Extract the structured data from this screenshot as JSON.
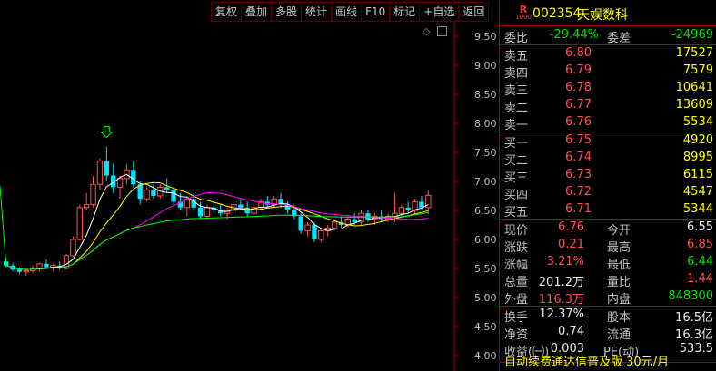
{
  "toolbar": {
    "buttons": [
      "复权",
      "叠加",
      "多股",
      "统计",
      "画线",
      "F10",
      "标记",
      "+自选",
      "返回"
    ]
  },
  "axis": {
    "ticks": [
      "9.50",
      "9.00",
      "8.50",
      "8.00",
      "7.50",
      "7.00",
      "6.50",
      "6.00",
      "5.50",
      "5.00",
      "4.50",
      "4.00"
    ],
    "tick_values": [
      9.5,
      9.0,
      8.5,
      8.0,
      7.5,
      7.0,
      6.5,
      6.0,
      5.5,
      5.0,
      4.5,
      4.0
    ]
  },
  "stock": {
    "badge_letter": "R",
    "badge_num": "1000",
    "code": "002354",
    "name": "天娱数科"
  },
  "commission": {
    "ratio_label": "委比",
    "ratio_value": "-29.44%",
    "diff_label": "委差",
    "diff_value": "-24969"
  },
  "asks": [
    {
      "label": "卖五",
      "price": "6.80",
      "volume": "17527"
    },
    {
      "label": "卖四",
      "price": "6.79",
      "volume": "7579"
    },
    {
      "label": "卖三",
      "price": "6.78",
      "volume": "10641"
    },
    {
      "label": "卖二",
      "price": "6.77",
      "volume": "13609"
    },
    {
      "label": "卖一",
      "price": "6.76",
      "volume": "5534"
    }
  ],
  "bids": [
    {
      "label": "买一",
      "price": "6.75",
      "volume": "4920"
    },
    {
      "label": "买二",
      "price": "6.74",
      "volume": "8995"
    },
    {
      "label": "买三",
      "price": "6.73",
      "volume": "6115"
    },
    {
      "label": "买四",
      "price": "6.72",
      "volume": "4547"
    },
    {
      "label": "买五",
      "price": "6.71",
      "volume": "5344"
    }
  ],
  "quote": {
    "current_label": "现价",
    "current": "6.76",
    "open_label": "今开",
    "open": "6.55",
    "change_label": "涨跌",
    "change": "0.21",
    "high_label": "最高",
    "high": "6.85",
    "pct_label": "涨幅",
    "pct": "3.21%",
    "low_label": "最低",
    "low": "6.44",
    "volume_label": "总量",
    "volume": "201.2万",
    "vol_ratio_label": "量比",
    "vol_ratio": "1.44",
    "outer_label": "外盘",
    "outer": "116.3万",
    "inner_label": "内盘",
    "inner": "848300"
  },
  "fundamentals": {
    "turnover_label": "换手",
    "turnover": "12.37%",
    "equity_label": "股本",
    "equity": "16.5亿",
    "netasset_label": "净资",
    "netasset": "0.74",
    "float_label": "流通",
    "float": "16.3亿",
    "eps_label": "收益(㈠)",
    "eps": "0.003",
    "pe_label": "PE(动)",
    "pe": "533.5"
  },
  "ticker": "自动续费通达信普及版 30元/月",
  "colors": {
    "up": "#ff5050",
    "down": "#00e5ff",
    "ma5": "#ffffff",
    "ma10": "#ffff00",
    "ma20": "#ff00ff",
    "ma60": "#00ff00"
  },
  "chart_data": {
    "type": "candlestick",
    "ylim": [
      4.0,
      9.5
    ],
    "candles": [
      [
        5.62,
        5.68,
        5.52,
        5.55
      ],
      [
        5.55,
        5.6,
        5.45,
        5.48
      ],
      [
        5.48,
        5.52,
        5.4,
        5.44
      ],
      [
        5.44,
        5.5,
        5.38,
        5.46
      ],
      [
        5.46,
        5.55,
        5.42,
        5.5
      ],
      [
        5.5,
        5.6,
        5.45,
        5.58
      ],
      [
        5.58,
        5.65,
        5.5,
        5.52
      ],
      [
        5.52,
        5.58,
        5.45,
        5.55
      ],
      [
        5.55,
        5.62,
        5.48,
        5.5
      ],
      [
        5.5,
        5.75,
        5.48,
        5.72
      ],
      [
        5.72,
        6.05,
        5.7,
        6.0
      ],
      [
        6.0,
        6.6,
        5.98,
        6.55
      ],
      [
        6.55,
        6.8,
        6.5,
        6.6
      ],
      [
        6.6,
        7.1,
        6.55,
        6.95
      ],
      [
        6.95,
        7.4,
        6.85,
        7.35
      ],
      [
        7.35,
        7.6,
        7.0,
        7.1
      ],
      [
        7.1,
        7.3,
        6.8,
        6.9
      ],
      [
        6.9,
        7.1,
        6.7,
        7.05
      ],
      [
        7.05,
        7.3,
        6.95,
        7.2
      ],
      [
        7.2,
        7.35,
        6.9,
        6.95
      ],
      [
        6.95,
        7.0,
        6.6,
        6.7
      ],
      [
        6.7,
        6.9,
        6.65,
        6.85
      ],
      [
        6.85,
        6.95,
        6.7,
        6.75
      ],
      [
        6.75,
        6.95,
        6.7,
        6.9
      ],
      [
        6.9,
        7.05,
        6.8,
        6.85
      ],
      [
        6.85,
        6.9,
        6.6,
        6.65
      ],
      [
        6.65,
        6.8,
        6.5,
        6.55
      ],
      [
        6.55,
        6.75,
        6.4,
        6.7
      ],
      [
        6.7,
        6.8,
        6.5,
        6.55
      ],
      [
        6.55,
        6.65,
        6.35,
        6.4
      ],
      [
        6.4,
        6.6,
        6.35,
        6.55
      ],
      [
        6.55,
        6.65,
        6.45,
        6.5
      ],
      [
        6.5,
        6.6,
        6.4,
        6.45
      ],
      [
        6.45,
        6.55,
        6.35,
        6.5
      ],
      [
        6.5,
        6.65,
        6.45,
        6.6
      ],
      [
        6.6,
        6.7,
        6.5,
        6.55
      ],
      [
        6.55,
        6.65,
        6.4,
        6.45
      ],
      [
        6.45,
        6.6,
        6.4,
        6.55
      ],
      [
        6.55,
        6.7,
        6.5,
        6.65
      ],
      [
        6.65,
        6.75,
        6.55,
        6.6
      ],
      [
        6.6,
        6.75,
        6.55,
        6.7
      ],
      [
        6.7,
        6.8,
        6.55,
        6.6
      ],
      [
        6.6,
        6.65,
        6.45,
        6.5
      ],
      [
        6.5,
        6.6,
        6.35,
        6.4
      ],
      [
        6.4,
        6.45,
        6.1,
        6.15
      ],
      [
        6.15,
        6.3,
        6.05,
        6.25
      ],
      [
        6.25,
        6.3,
        5.95,
        6.0
      ],
      [
        6.0,
        6.2,
        5.95,
        6.15
      ],
      [
        6.15,
        6.25,
        6.05,
        6.2
      ],
      [
        6.2,
        6.35,
        6.15,
        6.3
      ],
      [
        6.3,
        6.4,
        6.2,
        6.25
      ],
      [
        6.25,
        6.4,
        6.2,
        6.35
      ],
      [
        6.35,
        6.45,
        6.25,
        6.3
      ],
      [
        6.3,
        6.5,
        6.25,
        6.45
      ],
      [
        6.45,
        6.5,
        6.3,
        6.35
      ],
      [
        6.35,
        6.45,
        6.25,
        6.4
      ],
      [
        6.4,
        6.5,
        6.3,
        6.35
      ],
      [
        6.35,
        6.45,
        6.3,
        6.4
      ],
      [
        6.4,
        6.8,
        6.3,
        6.45
      ],
      [
        6.45,
        6.6,
        6.4,
        6.55
      ],
      [
        6.55,
        6.65,
        6.45,
        6.5
      ],
      [
        6.5,
        6.7,
        6.45,
        6.65
      ],
      [
        6.65,
        6.75,
        6.5,
        6.55
      ],
      [
        6.55,
        6.85,
        6.44,
        6.76
      ]
    ],
    "ma_series": [
      {
        "name": "MA5",
        "color": "#ffffff"
      },
      {
        "name": "MA10",
        "color": "#ffff00"
      },
      {
        "name": "MA20",
        "color": "#ff00ff"
      },
      {
        "name": "MA60",
        "color": "#00ff00"
      }
    ]
  }
}
